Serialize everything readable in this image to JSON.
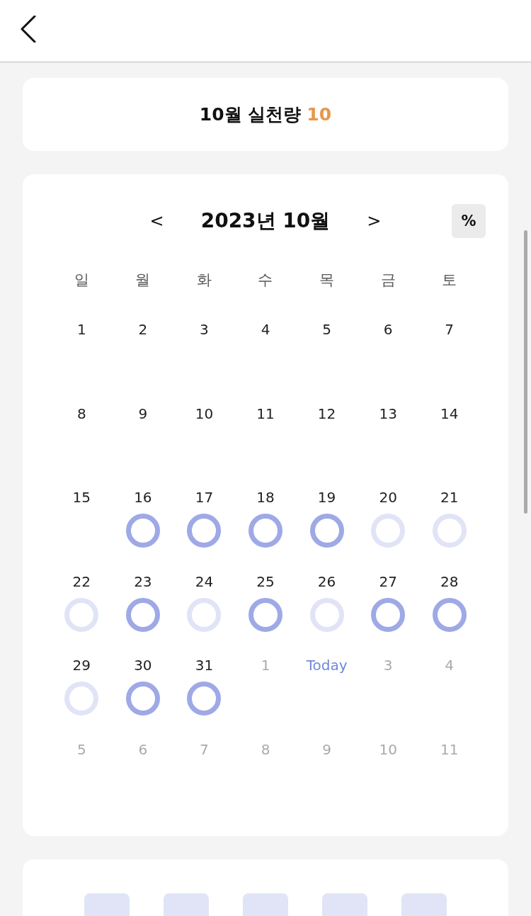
{
  "summary": {
    "label": "10월 실천량",
    "count": "10"
  },
  "calendar": {
    "prev": "<",
    "title": "2023년 10월",
    "next": ">",
    "mode_button": "%",
    "weekdays": [
      "일",
      "월",
      "화",
      "수",
      "목",
      "금",
      "토"
    ],
    "weeks": [
      [
        {
          "label": "1",
          "kind": "current"
        },
        {
          "label": "2",
          "kind": "current"
        },
        {
          "label": "3",
          "kind": "current"
        },
        {
          "label": "4",
          "kind": "current"
        },
        {
          "label": "5",
          "kind": "current"
        },
        {
          "label": "6",
          "kind": "current"
        },
        {
          "label": "7",
          "kind": "current"
        }
      ],
      [
        {
          "label": "8",
          "kind": "current"
        },
        {
          "label": "9",
          "kind": "current"
        },
        {
          "label": "10",
          "kind": "current"
        },
        {
          "label": "11",
          "kind": "current"
        },
        {
          "label": "12",
          "kind": "current"
        },
        {
          "label": "13",
          "kind": "current"
        },
        {
          "label": "14",
          "kind": "current"
        }
      ],
      [
        {
          "label": "15",
          "kind": "current"
        },
        {
          "label": "16",
          "kind": "current",
          "achieved": true
        },
        {
          "label": "17",
          "kind": "current",
          "achieved": true
        },
        {
          "label": "18",
          "kind": "current",
          "achieved": true
        },
        {
          "label": "19",
          "kind": "current",
          "achieved": true
        },
        {
          "label": "20",
          "kind": "current",
          "achieved": false
        },
        {
          "label": "21",
          "kind": "current",
          "achieved": false
        }
      ],
      [
        {
          "label": "22",
          "kind": "current",
          "achieved": false
        },
        {
          "label": "23",
          "kind": "current",
          "achieved": true
        },
        {
          "label": "24",
          "kind": "current",
          "achieved": false
        },
        {
          "label": "25",
          "kind": "current",
          "achieved": true
        },
        {
          "label": "26",
          "kind": "current",
          "achieved": false
        },
        {
          "label": "27",
          "kind": "current",
          "achieved": true
        },
        {
          "label": "28",
          "kind": "current",
          "achieved": true
        }
      ],
      [
        {
          "label": "29",
          "kind": "current",
          "achieved": false
        },
        {
          "label": "30",
          "kind": "current",
          "achieved": true
        },
        {
          "label": "31",
          "kind": "current",
          "achieved": true
        },
        {
          "label": "1",
          "kind": "other"
        },
        {
          "label": "Today",
          "kind": "today"
        },
        {
          "label": "3",
          "kind": "other"
        },
        {
          "label": "4",
          "kind": "other"
        }
      ],
      [
        {
          "label": "5",
          "kind": "other"
        },
        {
          "label": "6",
          "kind": "other"
        },
        {
          "label": "7",
          "kind": "other"
        },
        {
          "label": "8",
          "kind": "other"
        },
        {
          "label": "9",
          "kind": "other"
        },
        {
          "label": "10",
          "kind": "other"
        },
        {
          "label": "11",
          "kind": "other"
        }
      ]
    ]
  }
}
